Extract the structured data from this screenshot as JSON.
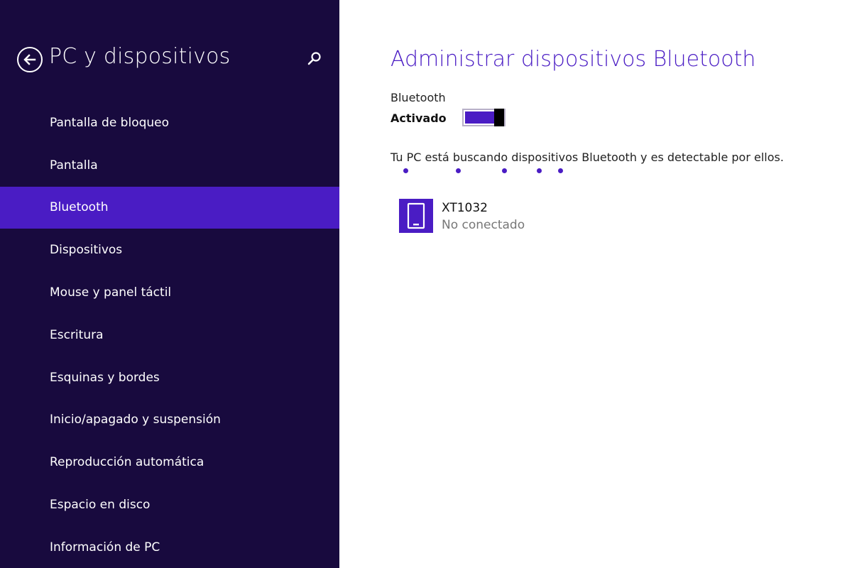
{
  "sidebar": {
    "title": "PC y dispositivos",
    "back_icon": "back-arrow-icon",
    "search_icon": "search-icon",
    "items": [
      {
        "label": "Pantalla de bloqueo"
      },
      {
        "label": "Pantalla"
      },
      {
        "label": "Bluetooth",
        "active": true
      },
      {
        "label": "Dispositivos"
      },
      {
        "label": "Mouse y panel táctil"
      },
      {
        "label": "Escritura"
      },
      {
        "label": "Esquinas y bordes"
      },
      {
        "label": "Inicio/apagado y suspensión"
      },
      {
        "label": "Reproducción automática"
      },
      {
        "label": "Espacio en disco"
      },
      {
        "label": "Información de PC"
      }
    ]
  },
  "main": {
    "title": "Administrar dispositivos Bluetooth",
    "bluetooth_label": "Bluetooth",
    "bluetooth_state": "Activado",
    "toggle_on": true,
    "status_text": "Tu PC está buscando dispositivos Bluetooth y es detectable por ellos.",
    "devices": [
      {
        "name": "XT1032",
        "status": "No conectado",
        "icon": "phone-icon"
      }
    ]
  },
  "colors": {
    "sidebar_bg": "#180a3e",
    "accent": "#4a1cc4",
    "text_dark": "#222222",
    "text_muted": "#777777"
  }
}
